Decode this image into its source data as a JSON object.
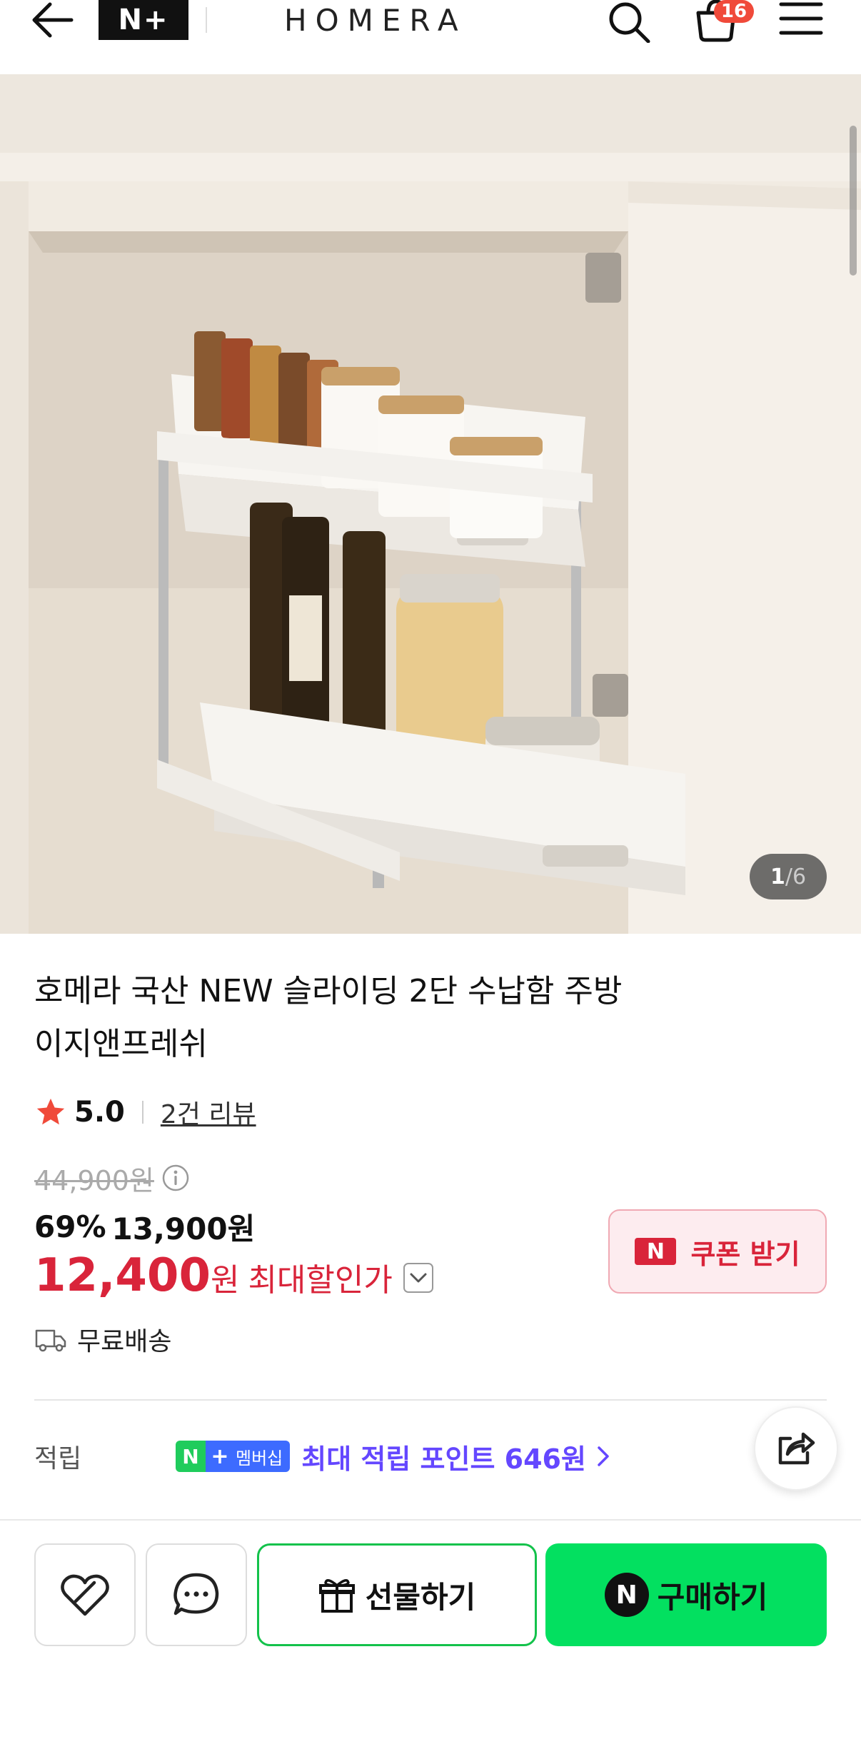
{
  "header": {
    "nplus_logo": "N+",
    "brand": "HOMERA",
    "cart_count": "16"
  },
  "gallery": {
    "current": "1",
    "separator": "/",
    "total": "6"
  },
  "product": {
    "title_line1": "호메라 국산 NEW 슬라이딩 2단 수납함 주방",
    "title_line2": "이지앤프레쉬",
    "rating": "5.0",
    "review_link": "2건 리뷰",
    "original_price": "44,900원",
    "discount_percent": "69%",
    "sale_price": "13,900원",
    "best_price_amount": "12,400",
    "best_price_unit": "원",
    "best_price_label": "최대할인가",
    "coupon_button": "쿠폰 받기",
    "coupon_logo": "N",
    "shipping": "무료배송",
    "points_label": "적립",
    "membership_n": "N",
    "membership_plus": "+",
    "membership_text": "멤버십",
    "points_text": "최대 적립 포인트 646원"
  },
  "bottom_bar": {
    "gift_button": "선물하기",
    "buy_button": "구매하기",
    "buy_logo": "N"
  },
  "colors": {
    "accent_red": "#d9243a",
    "naver_green": "#03e060",
    "points_purple": "#6447ff",
    "badge_red": "#f04a3a"
  }
}
